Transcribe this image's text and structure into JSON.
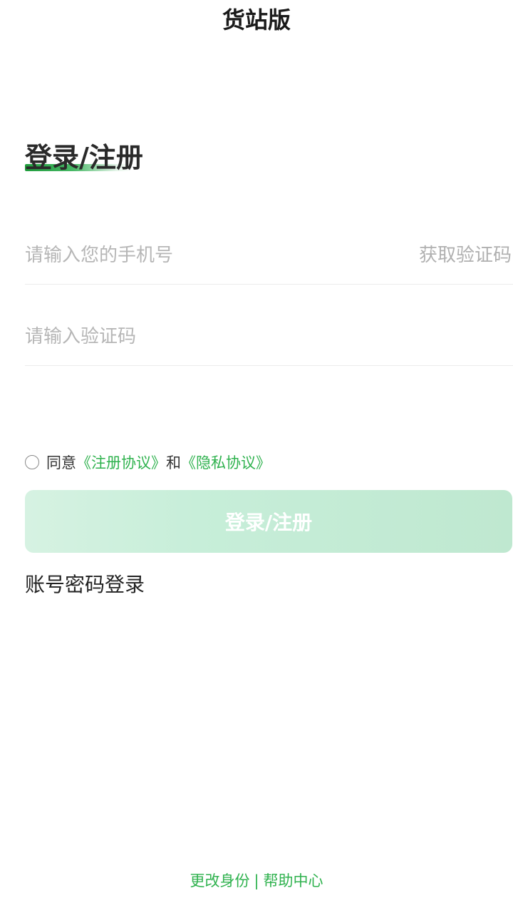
{
  "header": {
    "title": "货站版"
  },
  "login": {
    "heading": "登录/注册",
    "phone_placeholder": "请输入您的手机号",
    "get_code_label": "获取验证码",
    "code_placeholder": "请输入验证码",
    "agree_prefix": "同意",
    "register_agreement": "《注册协议》",
    "and_text": "和",
    "privacy_agreement": "《隐私协议》",
    "submit_label": "登录/注册",
    "password_login_label": "账号密码登录"
  },
  "footer": {
    "change_identity": "更改身份",
    "separator": "|",
    "help_center": "帮助中心"
  },
  "colors": {
    "accent": "#2fb24e",
    "button_bg": "#c7eed9",
    "placeholder": "#b6b6b6"
  }
}
